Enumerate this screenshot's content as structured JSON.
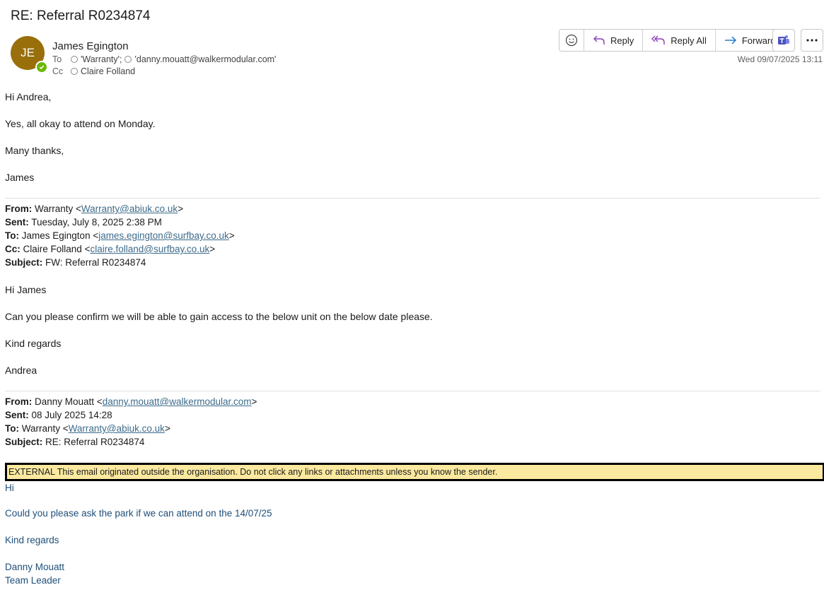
{
  "email": {
    "subject": "RE: Referral R0234874",
    "sender": {
      "initials": "JE",
      "name": "James Egington"
    },
    "to_label": "To",
    "to": [
      "'Warranty';",
      "'danny.mouatt@walkermodular.com'"
    ],
    "cc_label": "Cc",
    "cc": [
      "Claire Folland"
    ],
    "date": "Wed 09/07/2025 13:11"
  },
  "toolbar": {
    "reply_label": "Reply",
    "reply_all_label": "Reply All",
    "forward_label": "Forward"
  },
  "body": {
    "greeting": "Hi Andrea,",
    "line1": "Yes, all okay to attend on Monday.",
    "closing": "Many thanks,",
    "signature": "James"
  },
  "quote1": {
    "from_label": "From:",
    "from_name": "Warranty <",
    "from_email": "Warranty@abiuk.co.uk",
    "from_end": ">",
    "sent_label": "Sent:",
    "sent": "Tuesday, July 8, 2025 2:38 PM",
    "to_label": "To:",
    "to_name": "James Egington <",
    "to_email": "james.egington@surfbay.co.uk",
    "to_end": ">",
    "cc_label": "Cc:",
    "cc_name": "Claire Folland <",
    "cc_email": "claire.folland@surfbay.co.uk",
    "cc_end": ">",
    "subject_label": "Subject:",
    "subject": "FW: Referral R0234874",
    "greeting": "Hi James",
    "line1": "Can you please confirm we will be able to gain access to the below unit on the below date please.",
    "closing": "Kind regards",
    "signature": "Andrea"
  },
  "quote2": {
    "from_label": "From:",
    "from_name": "Danny Mouatt <",
    "from_email": "danny.mouatt@walkermodular.com",
    "from_end": ">",
    "sent_label": "Sent:",
    "sent": "08 July 2025 14:28",
    "to_label": "To:",
    "to_name": "Warranty <",
    "to_email": "Warranty@abiuk.co.uk",
    "to_end": ">",
    "subject_label": "Subject:",
    "subject": "RE: Referral R0234874",
    "banner": "EXTERNAL This email originated outside the organisation. Do not click any links or attachments unless you know the sender.",
    "greeting": "Hi",
    "line1": "Could you please ask the park if we can attend on the 14/07/25",
    "closing": "Kind regards",
    "signature_name": "Danny Mouatt",
    "signature_title": "Team Leader"
  },
  "colors": {
    "avatar": "#986f0b",
    "presence": "#6bb700",
    "banner": "#fbe9a0",
    "link": "#3d6b8a",
    "quote_text": "#1f4e79"
  }
}
